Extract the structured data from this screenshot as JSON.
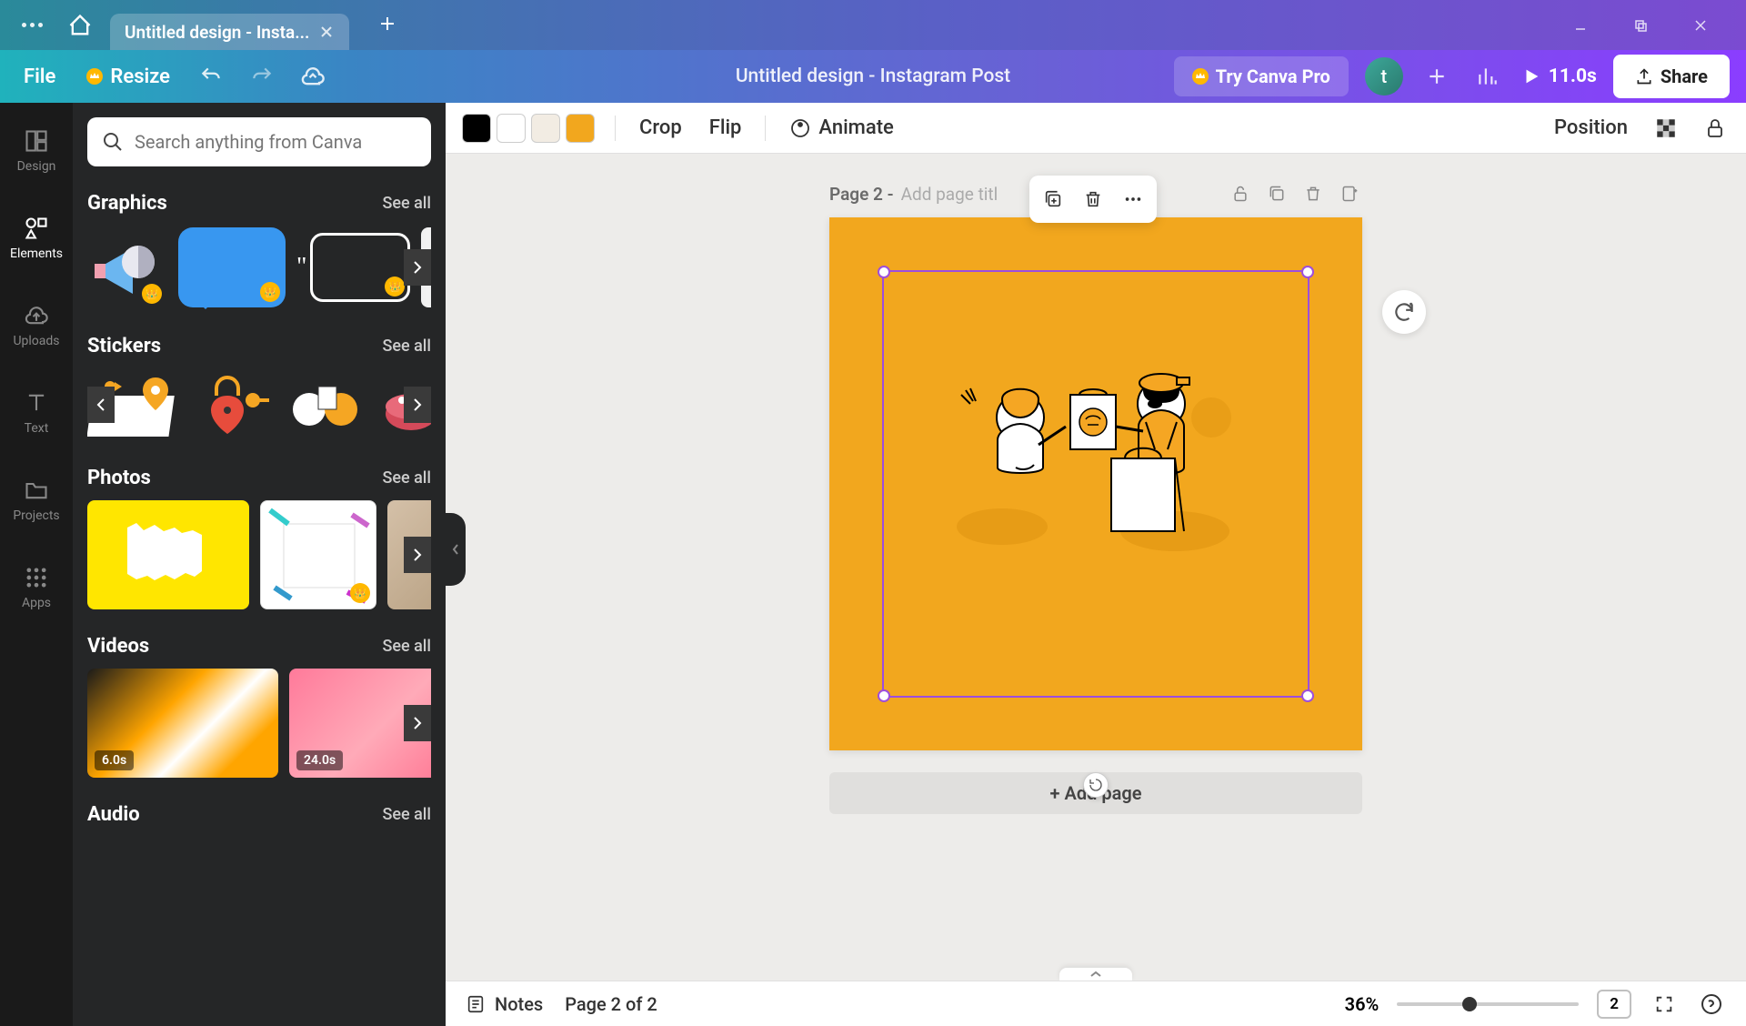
{
  "titlebar": {
    "tab_title": "Untitled design - Insta..."
  },
  "toolbar": {
    "file": "File",
    "resize": "Resize",
    "doc_title": "Untitled design - Instagram Post",
    "try_pro": "Try Canva Pro",
    "avatar_letter": "t",
    "duration": "11.0s",
    "share": "Share"
  },
  "leftnav": {
    "design": "Design",
    "elements": "Elements",
    "uploads": "Uploads",
    "text": "Text",
    "projects": "Projects",
    "apps": "Apps"
  },
  "panel": {
    "search_placeholder": "Search anything from Canva",
    "see_all": "See all",
    "sections": {
      "graphics": "Graphics",
      "stickers": "Stickers",
      "photos": "Photos",
      "videos": "Videos",
      "audio": "Audio"
    },
    "video_durations": [
      "6.0s",
      "24.0s"
    ]
  },
  "canvas_toolbar": {
    "colors": [
      "#000000",
      "#ffffff",
      "#f2ece3",
      "#f2a71e"
    ],
    "crop": "Crop",
    "flip": "Flip",
    "animate": "Animate",
    "position": "Position"
  },
  "canvas": {
    "page_label": "Page 2 -",
    "page_title_placeholder": "Add page titl",
    "add_page": "+ Add page"
  },
  "bottom_bar": {
    "notes": "Notes",
    "page_info": "Page 2 of 2",
    "zoom": "36%",
    "page_count": "2"
  }
}
